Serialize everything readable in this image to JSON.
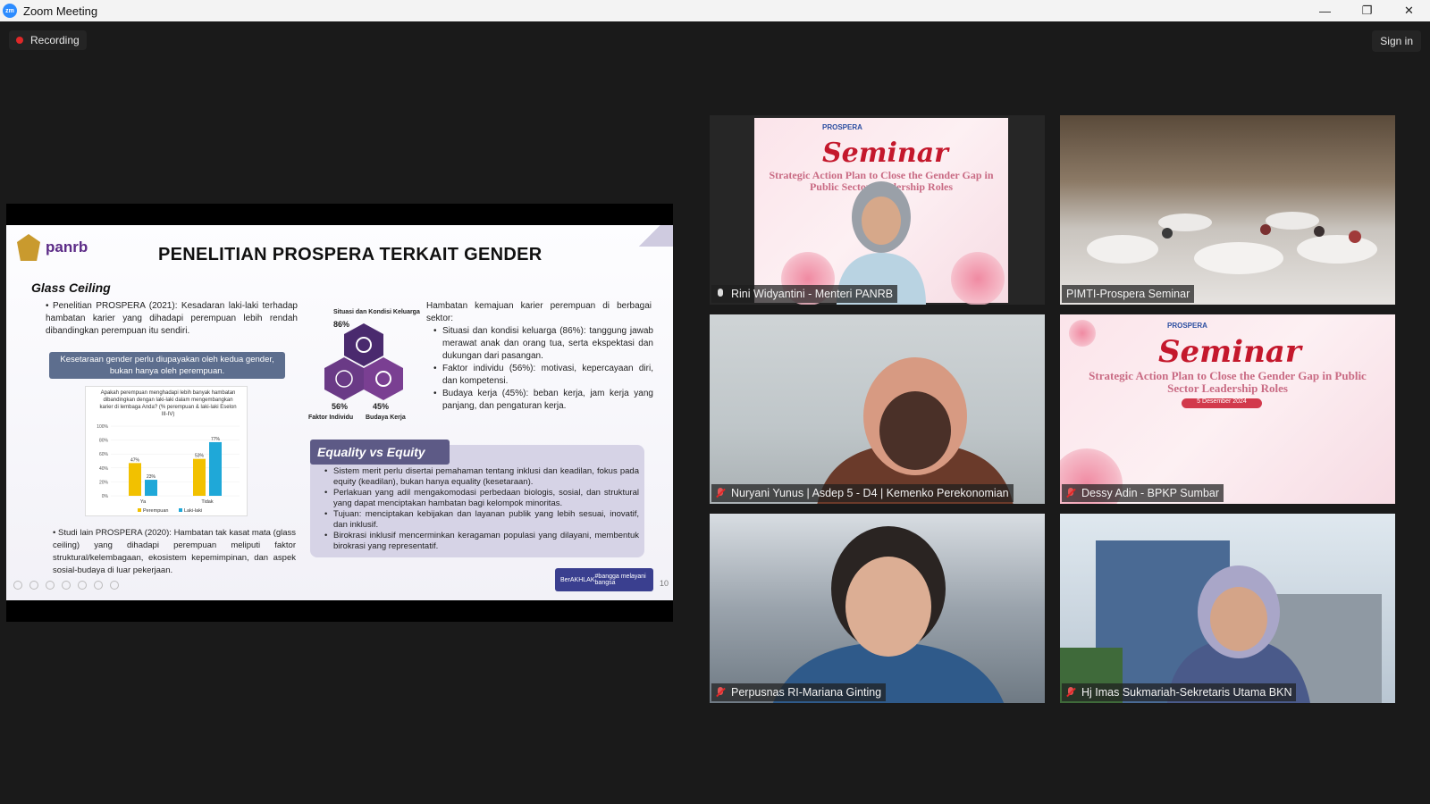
{
  "window": {
    "title": "Zoom Meeting",
    "logo": "zm",
    "minimize": "—",
    "restore": "❐",
    "close": "✕"
  },
  "topbar": {
    "recording_label": "Recording",
    "signin_label": "Sign in"
  },
  "slide": {
    "org_logo_text": "panrb",
    "title": "PENELITIAN PROSPERA TERKAIT GENDER",
    "section_glass": "Glass Ceiling",
    "bullet1": "• Penelitian PROSPERA (2021): Kesadaran laki-laki terhadap hambatan karier yang dihadapi perempuan lebih rendah dibandingkan perempuan itu sendiri.",
    "callout": "Kesetaraan gender perlu diupayakan oleh kedua gender, bukan hanya oleh perempuan.",
    "chart_question": "Apakah perempuan menghadapi lebih banyak hambatan dibandingkan dengan laki-laki dalam mengembangkan karier di lembaga Anda? (% perempuan & laki-laki Eselon III-IV)",
    "bullet2": "• Studi lain PROSPERA (2020): Hambatan tak kasat mata (glass ceiling) yang dihadapi perempuan meliputi faktor struktural/kelembagaan, ekosistem kepemimpinan, dan aspek sosial-budaya di luar pekerjaan.",
    "hex_top_label": "Situasi dan Kondisi Keluarga",
    "hex_top_pct": "86%",
    "hex_left_label": "Faktor Individu",
    "hex_left_pct": "56%",
    "hex_right_label": "Budaya Kerja",
    "hex_right_pct": "45%",
    "right_intro": "Hambatan kemajuan karier perempuan di berbagai sektor:",
    "right_items": [
      "Situasi dan kondisi keluarga (86%): tanggung jawab merawat anak dan orang tua, serta ekspektasi dan dukungan dari pasangan.",
      "Faktor individu (56%): motivasi, kepercayaan diri, dan kompetensi.",
      "Budaya kerja (45%): beban kerja, jam kerja yang panjang, dan pengaturan kerja."
    ],
    "eq_title": "Equality vs Equity",
    "eq_items": [
      "Sistem merit perlu disertai pemahaman tentang inklusi dan keadilan, fokus pada equity (keadilan), bukan hanya equality (kesetaraan).",
      "Perlakuan yang adil mengakomodasi perbedaan biologis, sosial, dan struktural yang dapat menciptakan hambatan bagi kelompok minoritas.",
      "Tujuan: menciptakan kebijakan dan layanan publik yang lebih sesuai, inovatif, dan inklusif.",
      "Birokrasi inklusif mencerminkan keragaman populasi yang dilayani, membentuk birokrasi yang representatif."
    ],
    "footer_left": "BerAKHLAK",
    "footer_right": "#bangga melayani bangsa",
    "page_number": "10"
  },
  "chart_data": {
    "type": "bar",
    "categories": [
      "Ya",
      "Tidak"
    ],
    "series": [
      {
        "name": "Perempuan",
        "values": [
          47,
          53
        ],
        "color": "#f2c100"
      },
      {
        "name": "Laki-laki",
        "values": [
          23,
          77
        ],
        "color": "#1fa8d8"
      }
    ],
    "ylim": [
      0,
      100
    ],
    "yticks": [
      "0%",
      "20%",
      "40%",
      "60%",
      "80%",
      "100%"
    ],
    "value_labels": [
      "47%",
      "23%",
      "53%",
      "77%"
    ]
  },
  "seminar": {
    "word": "Seminar",
    "subtitle": "Strategic Action Plan to Close the Gender Gap in Public Sector Leadership Roles",
    "date": "5 Desember 2024",
    "logos": "PROSPERA"
  },
  "participants": [
    {
      "name": "Rini Widyantini - Menteri PANRB",
      "muted": false,
      "active": true
    },
    {
      "name": "PIMTI-Prospera Seminar",
      "muted": false,
      "active": false
    },
    {
      "name": "Nuryani Yunus | Asdep 5 - D4 | Kemenko Perekonomian",
      "muted": true,
      "active": false
    },
    {
      "name": "Dessy Adin - BPKP Sumbar",
      "muted": true,
      "active": false
    },
    {
      "name": "Perpusnas RI-Mariana Ginting",
      "muted": true,
      "active": false
    },
    {
      "name": "Hj Imas Sukmariah-Sekretaris Utama BKN",
      "muted": true,
      "active": false
    }
  ]
}
